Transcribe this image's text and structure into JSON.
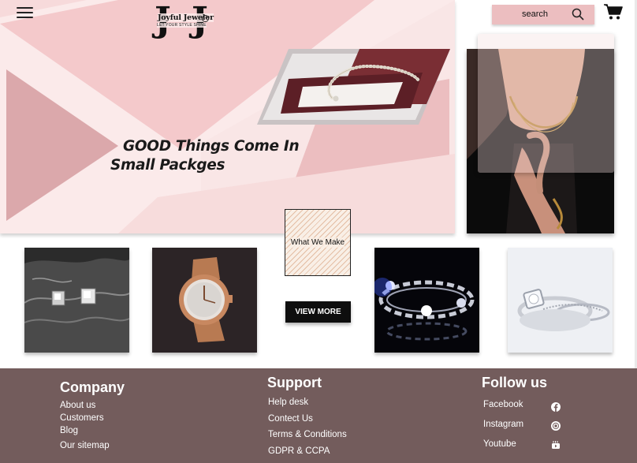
{
  "header": {
    "menu_icon": "hamburger-menu-icon",
    "logo": {
      "monogram_left": "J",
      "monogram_right": "J",
      "name": "Joyful Jeweler",
      "tagline": "LET YOUR STYLE SHINE"
    },
    "search": {
      "placeholder": "search",
      "icon": "search-icon"
    },
    "cart_icon": "shopping-cart-icon"
  },
  "hero": {
    "headline_line1": "GOOD Things Come In",
    "headline_line2": "Small Packges",
    "image_left": "pearl-necklace-in-box",
    "image_right": "model-wearing-gold-chain"
  },
  "products": {
    "items": [
      {
        "image": "diamond-stud-earrings"
      },
      {
        "image": "rose-gold-watch"
      },
      {
        "image": "diamond-tennis-bracelet"
      },
      {
        "image": "diamond-engagement-rings"
      }
    ],
    "section_label": "What We Make",
    "view_more_label": "VIEW MORE"
  },
  "footer": {
    "company": {
      "title": "Company",
      "links": [
        "About us",
        "Customers",
        "Blog",
        "Our sitemap"
      ]
    },
    "support": {
      "title": "Support",
      "links": [
        "Help desk",
        "Contect Us",
        "Terms & Conditions",
        "GDPR & CCPA"
      ]
    },
    "follow": {
      "title": "Follow us",
      "links": [
        {
          "label": "Facebook",
          "icon": "facebook-icon"
        },
        {
          "label": "Instagram",
          "icon": "instagram-icon"
        },
        {
          "label": "Youtube",
          "icon": "youtube-icon"
        }
      ]
    }
  },
  "colors": {
    "hero_bg": "#fbeaea",
    "hero_pink": "#ecbec0",
    "hero_mauve": "#d9a7ab",
    "footer_bg": "#735c5c",
    "button_bg": "#0e0e0e"
  }
}
